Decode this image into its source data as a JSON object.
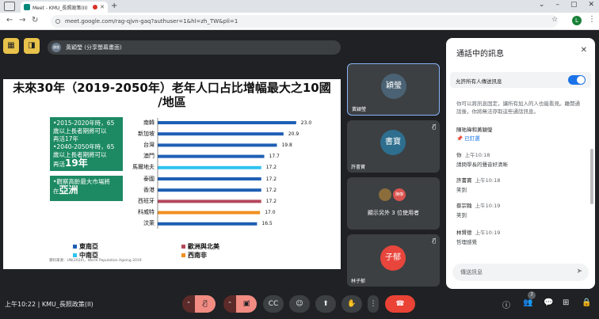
{
  "browser": {
    "tab_title": "Meet - KMU_長照政策(II)",
    "url": "meet.google.com/rag-qjvn-gaq?authuser=1&hl=zh_TW&pli=1",
    "profile_initial": "L"
  },
  "presenter": {
    "avatar_text": "穎瑩",
    "label": "黃穎瑩 (分享螢幕畫面)"
  },
  "slide": {
    "title_line1": "未來30年（2019-2050年）老年人口占比增幅最大之10國",
    "title_line2": "/地區",
    "box1": {
      "line1": "•2015-2020年時，65",
      "line2": "歲以上長者期將可以",
      "line3": "再活17年",
      "line4": "•2040-2050年時，65",
      "line5": "歲以上長者期將可以",
      "line6_prefix": "再活",
      "line6_big": "19年"
    },
    "box2": {
      "line1": "•觀察高齡最大市場將",
      "line2_prefix": "在",
      "line2_big": "亞洲"
    },
    "source": "資料來源：UN(2020)，World Population Ageing 2019"
  },
  "chart_data": {
    "type": "bar",
    "orientation": "horizontal",
    "categories": [
      "南韓",
      "新加坡",
      "台灣",
      "澳門",
      "馬爾地夫",
      "泰國",
      "香港",
      "西班牙",
      "科威特",
      "汶萊"
    ],
    "values": [
      23.0,
      20.9,
      19.8,
      17.7,
      17.2,
      17.2,
      17.2,
      17.2,
      17.0,
      16.5
    ],
    "value_labels": [
      "23.0",
      "20.9",
      "19.8",
      "17.7",
      "17.2",
      "17.2",
      "17.2",
      "17.2",
      "17.0",
      "16.5"
    ],
    "bar_colors": [
      "#1e5fb4",
      "#1e5fb4",
      "#1e5fb4",
      "#1e5fb4",
      "#2fc3f0",
      "#1e5fb4",
      "#1e5fb4",
      "#b5475c",
      "#f0901e",
      "#1e5fb4"
    ],
    "legend": [
      {
        "name": "東南亞",
        "color": "#1e5fb4"
      },
      {
        "name": "歐洲與北美",
        "color": "#b5475c"
      },
      {
        "name": "中南亞",
        "color": "#2fc3f0"
      },
      {
        "name": "西南非",
        "color": "#f0901e"
      }
    ],
    "xlim": [
      0,
      25
    ]
  },
  "participants": [
    {
      "avatar_text": "穎瑩",
      "name": "黃穎瑩",
      "avatar_color": "#4a6274"
    },
    {
      "avatar_text": "書寶",
      "name": "許書寶",
      "avatar_color": "#2e6e8e"
    },
    {
      "avatar_text": "陳傑",
      "name": "",
      "others_text": "顯示另外 3 位使用者",
      "avatar_color": "#d9534f"
    },
    {
      "avatar_text": "子郁",
      "name": "林子郁",
      "avatar_color": "#e8453c"
    }
  ],
  "chat": {
    "title": "通話中的訊息",
    "toggle_label": "允許所有人傳送訊息",
    "notice": "你可以將訊息固定，讓所有加入的人也能看見。離開通話後，你將無法存取這些通話訊息。",
    "messages": [
      {
        "sender": "陳祐瑋和黃穎瑩",
        "time": "",
        "body": "",
        "link": "已釘選"
      },
      {
        "sender": "你",
        "time": "上午10:18",
        "body": "請問學長的聲音好清晰"
      },
      {
        "sender": "許書寶",
        "time": "上午10:18",
        "body": "笑到"
      },
      {
        "sender": "蔡宗翰",
        "time": "上午10:19",
        "body": "笑到"
      },
      {
        "sender": "林賢德",
        "time": "上午10:19",
        "body": "哲理感覺"
      }
    ],
    "input_placeholder": "傳送訊息"
  },
  "controls": {
    "clock": "上午10:22",
    "meeting_name": "KMU_長照政策(II)",
    "badge_count": "7"
  }
}
